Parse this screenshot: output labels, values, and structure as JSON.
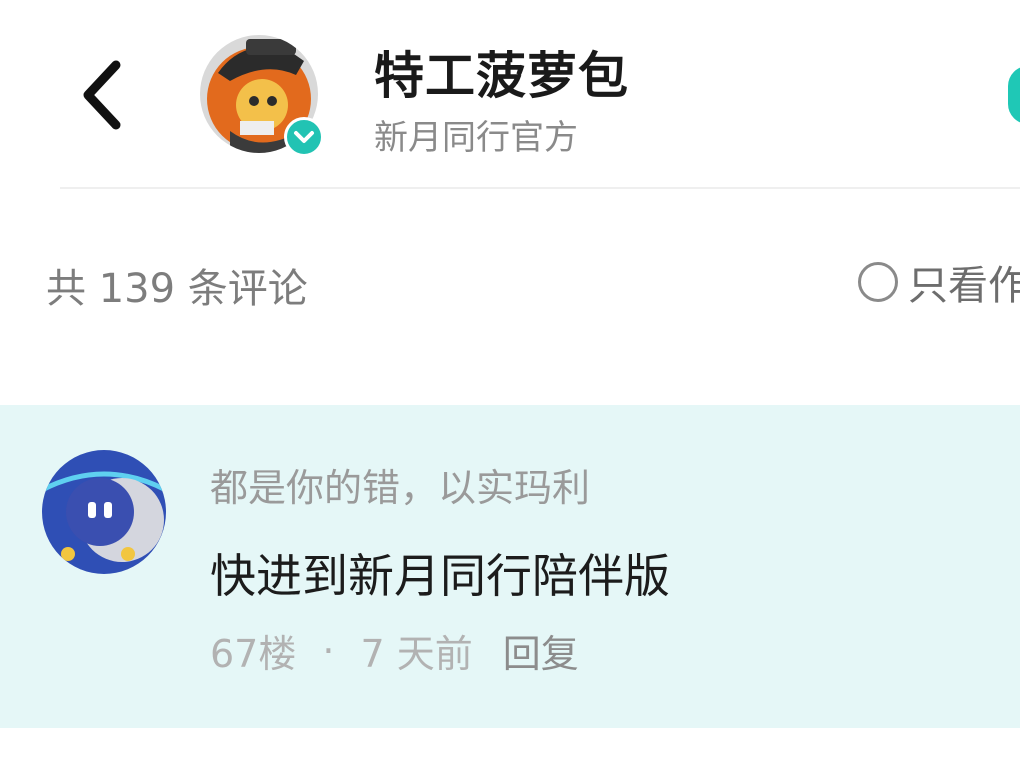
{
  "header": {
    "back_icon": "chevron-left-icon",
    "author_name": "特工菠萝包",
    "author_subtitle": "新月同行官方",
    "verified_icon": "verified-check-icon",
    "accent_color": "#22c3b3"
  },
  "comments_bar": {
    "count_text": "共 139 条评论",
    "only_author_label": "只看作者",
    "only_author_checked": false
  },
  "comment": {
    "username": "都是你的错，以实玛利",
    "text": "快进到新月同行陪伴版",
    "floor": "67楼",
    "separator": "·",
    "time": "7 天前",
    "reply_label": "回复",
    "highlight_color": "#e5f7f7"
  }
}
